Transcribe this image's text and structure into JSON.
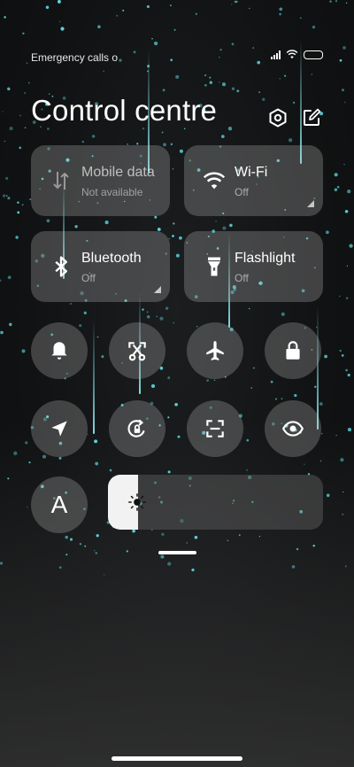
{
  "status_bar": {
    "carrier_text": "Emergency calls o"
  },
  "header": {
    "title": "Control centre"
  },
  "tiles": [
    {
      "label": "Mobile data",
      "status": "Not available"
    },
    {
      "label": "Wi-Fi",
      "status": "Off"
    },
    {
      "label": "Bluetooth",
      "status": "Off"
    },
    {
      "label": "Flashlight",
      "status": "Off"
    }
  ],
  "toggles": [
    {
      "icon": "bell-icon"
    },
    {
      "icon": "screenshot-scissors-icon"
    },
    {
      "icon": "airplane-icon"
    },
    {
      "icon": "lock-icon"
    },
    {
      "icon": "location-arrow-icon"
    },
    {
      "icon": "rotation-lock-icon"
    },
    {
      "icon": "scanner-icon"
    },
    {
      "icon": "eye-icon"
    },
    {
      "icon": "auto-brightness-icon",
      "label": "A"
    }
  ],
  "brightness": {
    "level": 0.14
  },
  "colors": {
    "accent": "#5ee0e8",
    "tile_bg": "rgba(190,190,190,0.28)"
  }
}
